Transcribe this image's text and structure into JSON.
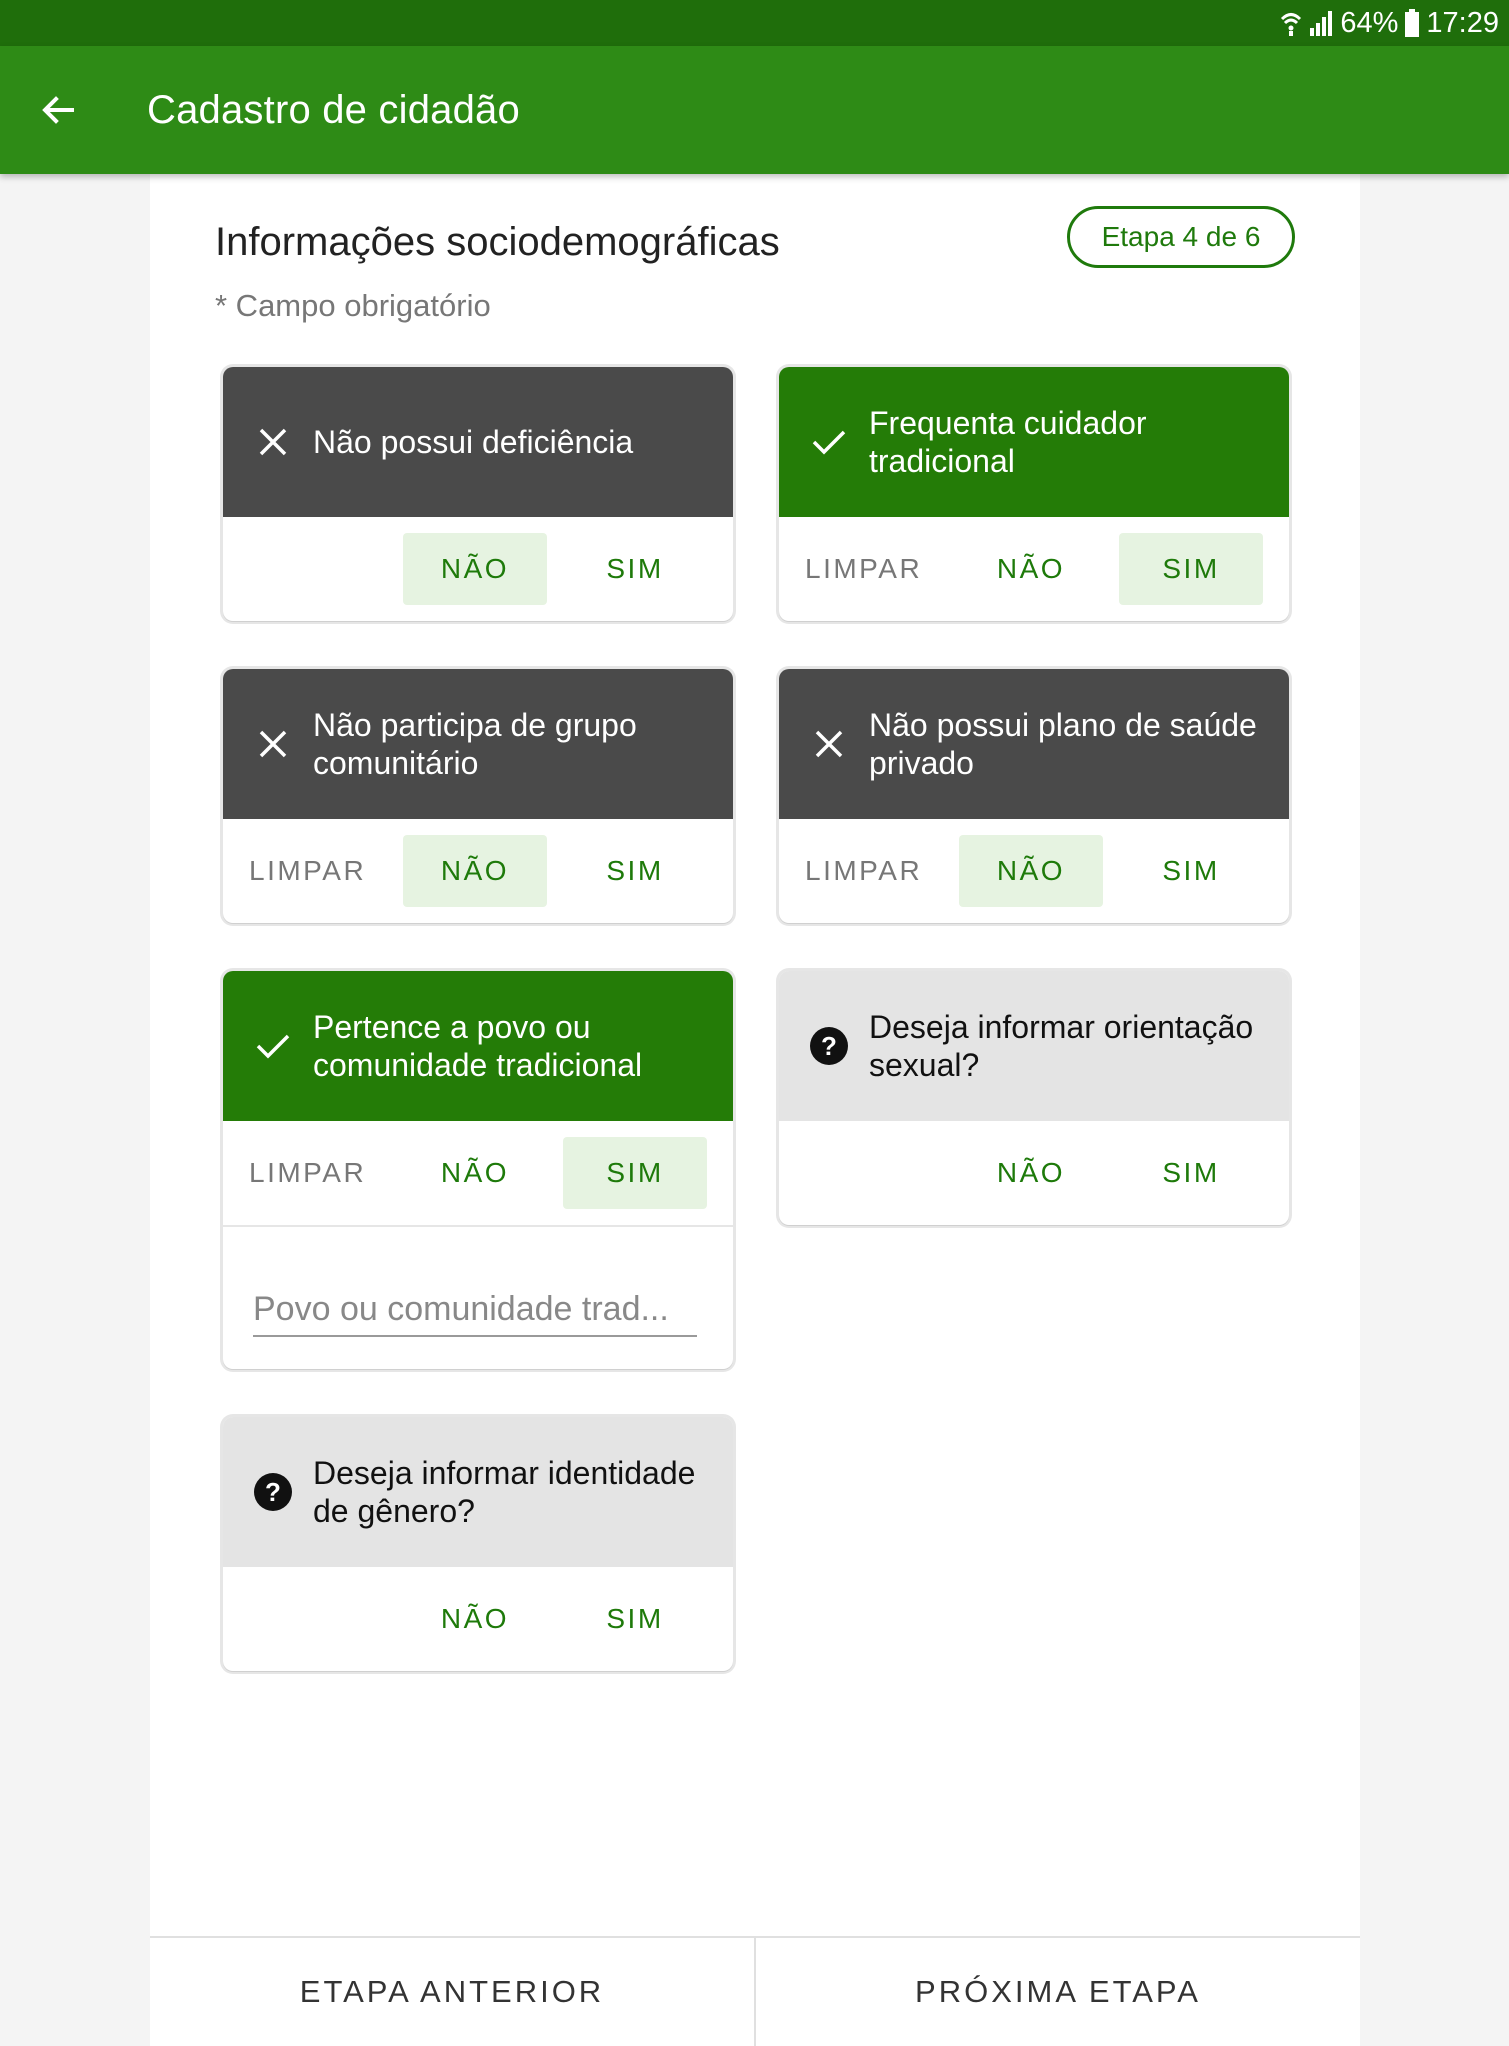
{
  "status_bar": {
    "battery": "64%",
    "time": "17:29"
  },
  "app_bar": {
    "title": "Cadastro de cidadão"
  },
  "form": {
    "section_title": "Informações sociodemográficas",
    "required_note": "* Campo obrigatório",
    "step_badge": "Etapa 4 de 6"
  },
  "actions": {
    "clear": "LIMPAR",
    "no": "NÃO",
    "yes": "SIM"
  },
  "cards": [
    {
      "label": "Não possui deficiência",
      "state": "no",
      "icon": "close-icon"
    },
    {
      "label": "Frequenta cuidador tradicional",
      "state": "yes",
      "icon": "check-icon"
    },
    {
      "label": "Não participa de grupo comunitário",
      "state": "no",
      "icon": "close-icon"
    },
    {
      "label": "Não possui plano de saúde privado",
      "state": "no",
      "icon": "close-icon"
    },
    {
      "label": "Pertence a povo ou comunidade tradicional",
      "state": "yes",
      "icon": "check-icon",
      "field_placeholder": "Povo ou comunidade trad..."
    },
    {
      "label": "Deseja informar orientação sexual?",
      "state": "unanswered",
      "icon": "help-icon"
    },
    {
      "label": "Deseja informar identidade de gênero?",
      "state": "unanswered",
      "icon": "help-icon"
    }
  ],
  "footer": {
    "prev": "ETAPA ANTERIOR",
    "next": "PRÓXIMA ETAPA"
  },
  "colors": {
    "status_bar": "#1f6e0b",
    "app_bar": "#2e8b16",
    "accent": "#1e7a0a",
    "dark_card": "#4a4a4a",
    "selected_bg": "#e6f3e1"
  }
}
